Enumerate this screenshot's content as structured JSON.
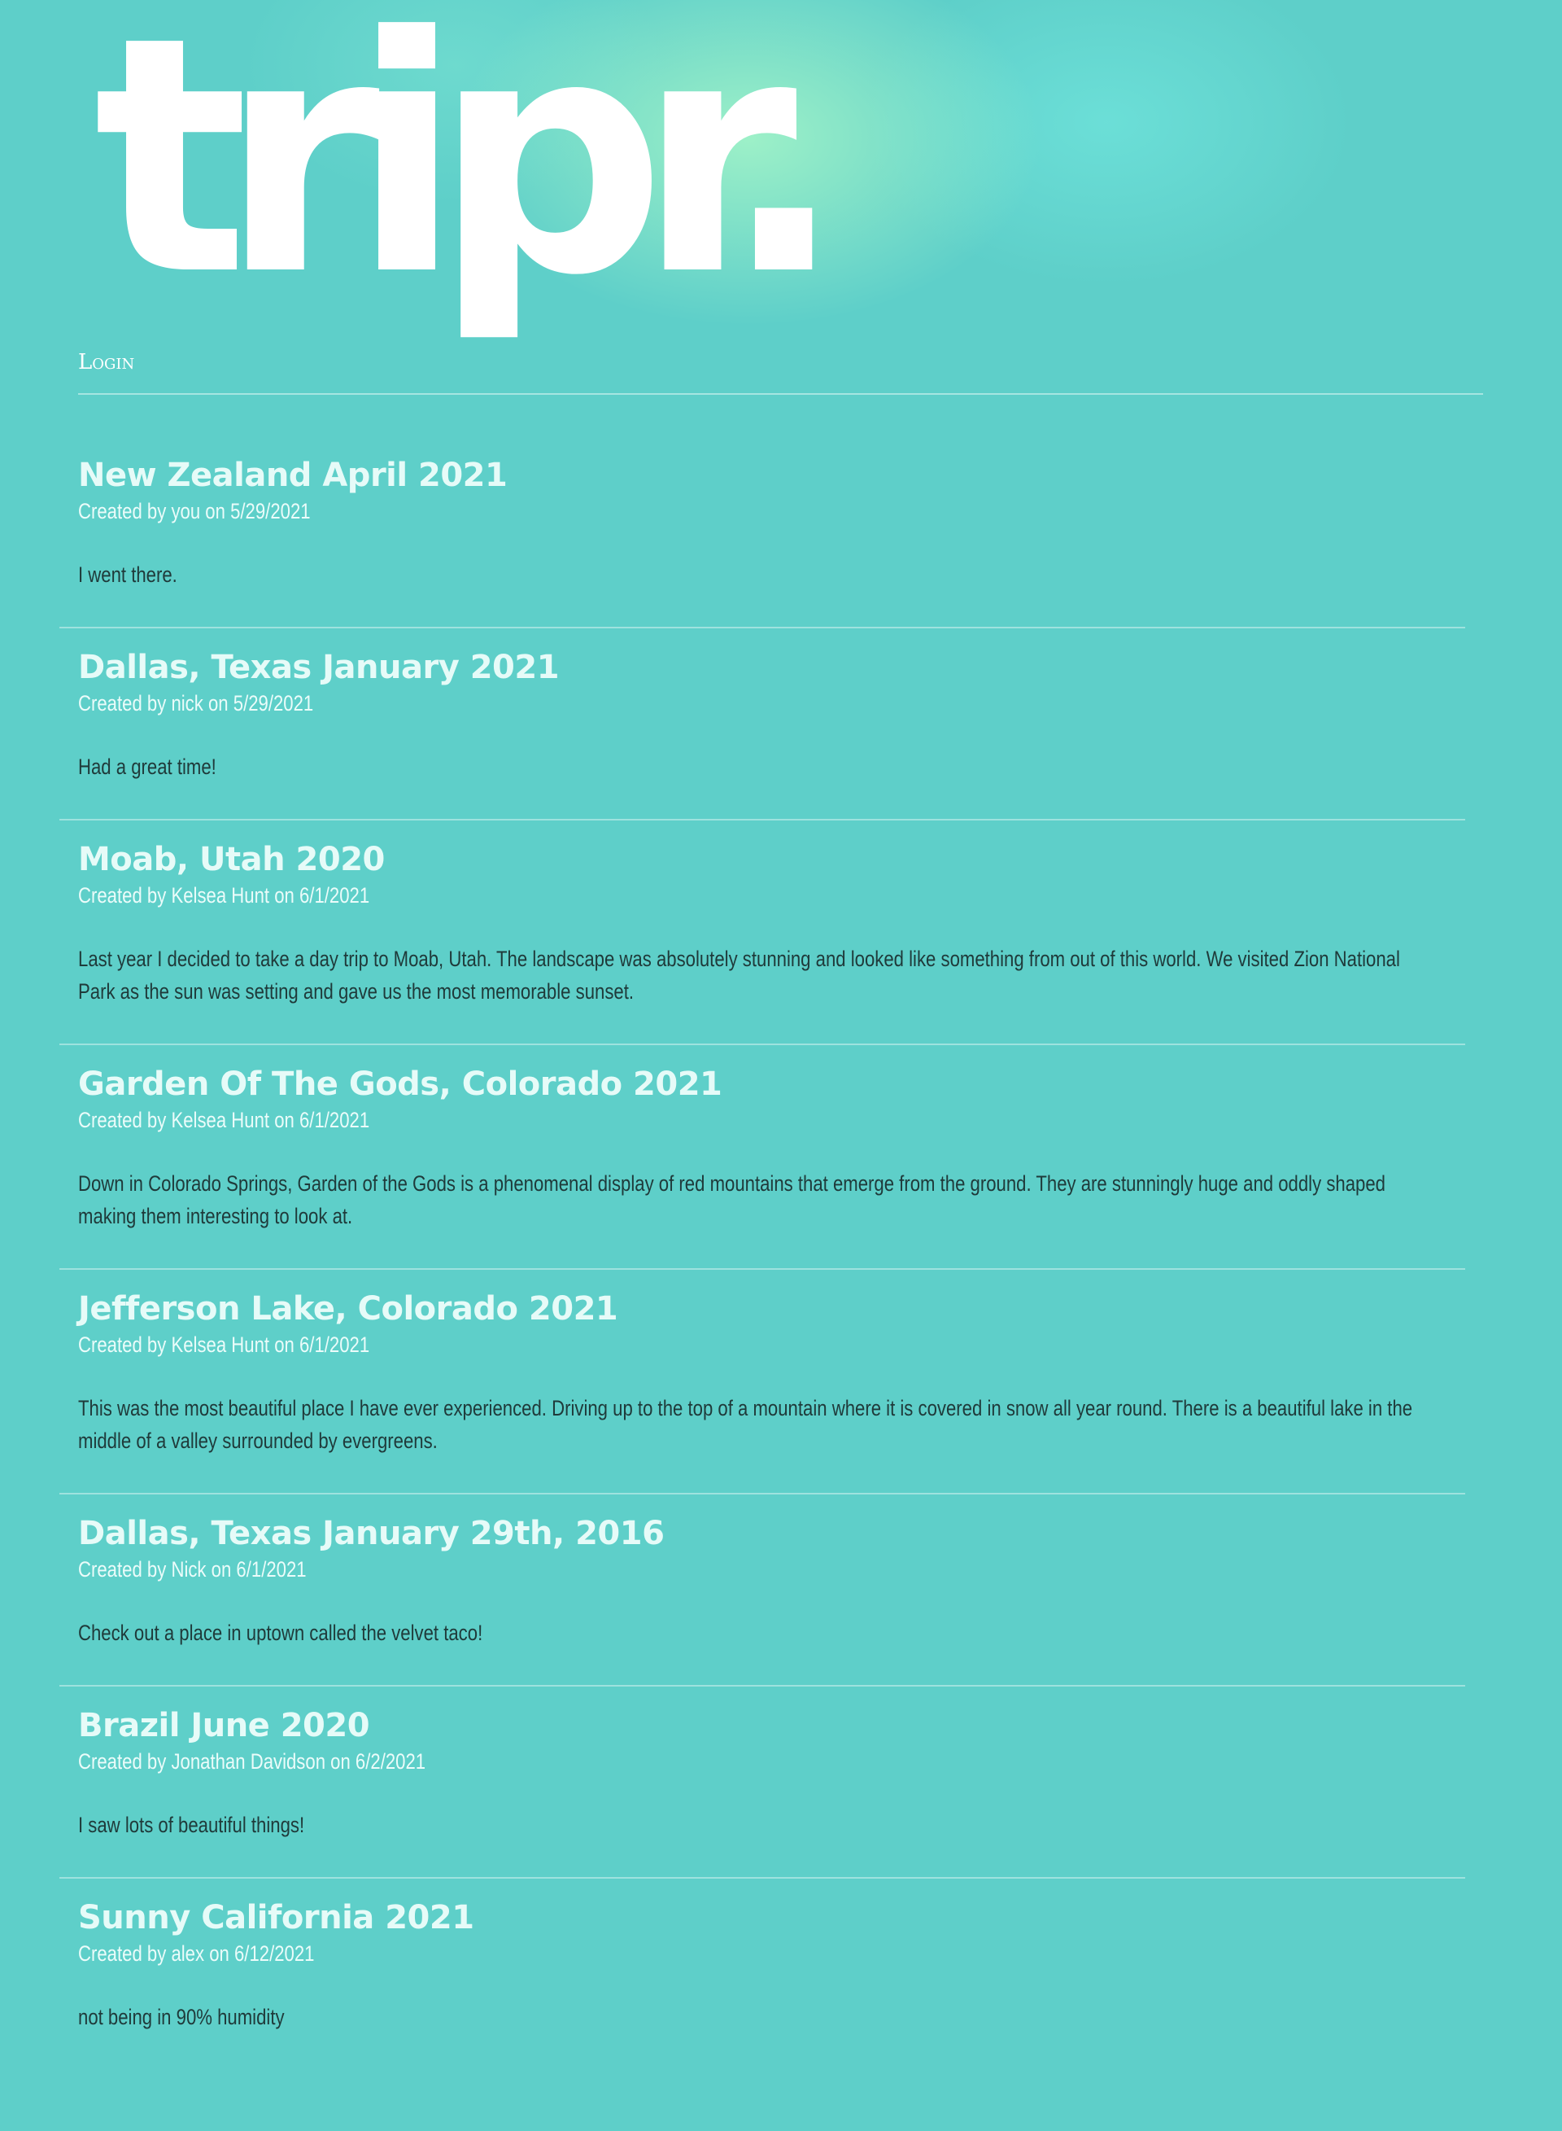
{
  "site": {
    "logo_text": "tripr.",
    "login_label": "Login"
  },
  "posts": [
    {
      "title": "New Zealand April 2021",
      "meta": "Created by you on 5/29/2021",
      "body": "I went there."
    },
    {
      "title": "Dallas, Texas January 2021",
      "meta": "Created by nick on 5/29/2021",
      "body": "Had a great time!"
    },
    {
      "title": "Moab, Utah 2020",
      "meta": "Created by Kelsea Hunt on 6/1/2021",
      "body": "Last year I decided to take a day trip to Moab, Utah. The landscape was absolutely stunning and looked like something from out of this world. We visited Zion National Park as the sun was setting and gave us the most memorable sunset."
    },
    {
      "title": "Garden Of The Gods, Colorado 2021",
      "meta": "Created by Kelsea Hunt on 6/1/2021",
      "body": "Down in Colorado Springs, Garden of the Gods is a phenomenal display of red mountains that emerge from the ground. They are stunningly huge and oddly shaped making them interesting to look at."
    },
    {
      "title": "Jefferson Lake, Colorado 2021",
      "meta": "Created by Kelsea Hunt on 6/1/2021",
      "body": "This was the most beautiful place I have ever experienced. Driving up to the top of a mountain where it is covered in snow all year round. There is a beautiful lake in the middle of a valley surrounded by evergreens."
    },
    {
      "title": "Dallas, Texas January 29th, 2016",
      "meta": "Created by Nick on 6/1/2021",
      "body": "Check out a place in uptown called the velvet taco!"
    },
    {
      "title": "Brazil June 2020",
      "meta": "Created by Jonathan Davidson on 6/2/2021",
      "body": "I saw lots of beautiful things!"
    },
    {
      "title": "Sunny California 2021",
      "meta": "Created by alex on 6/12/2021",
      "body": "not being in 90% humidity"
    }
  ],
  "colors": {
    "background": "#5ecfc9",
    "title": "#e6fbf8",
    "body_text": "#1f3a3a"
  }
}
